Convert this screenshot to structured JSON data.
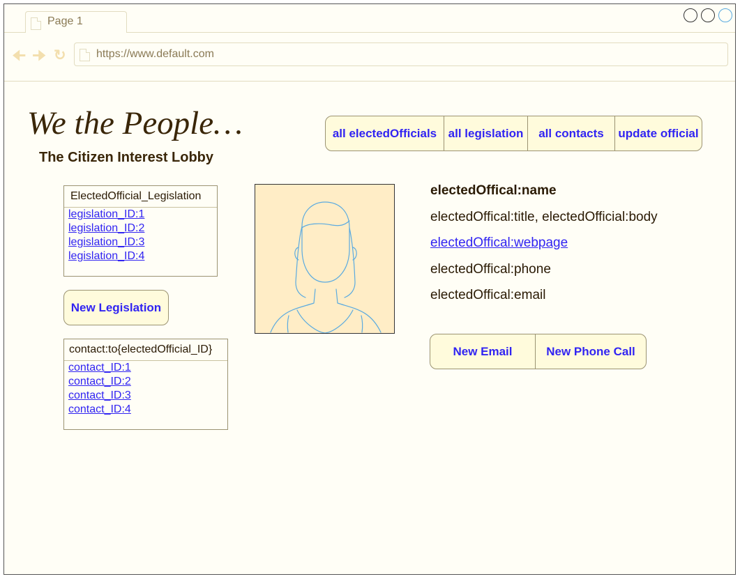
{
  "browser": {
    "tab_title": "Page 1",
    "url": "https://www.default.com"
  },
  "header": {
    "brand": "We the People…",
    "tagline": "The Citizen Interest Lobby"
  },
  "nav": {
    "items": [
      {
        "label": "all electedOfficials"
      },
      {
        "label": "all legislation"
      },
      {
        "label": "all contacts"
      },
      {
        "label": "update official"
      }
    ]
  },
  "legislation_panel": {
    "title": "ElectedOfficial_Legislation",
    "items": [
      "legislation_ID:1",
      "legislation_ID:2",
      "legislation_ID:3",
      "legislation_ID:4"
    ],
    "new_button": "New Legislation"
  },
  "contacts_panel": {
    "title": "contact:to{electedOfficial_ID}",
    "items": [
      "contact_ID:1",
      "contact_ID:2",
      "contact_ID:3",
      "contact_ID:4"
    ]
  },
  "official": {
    "name": "electedOffical:name",
    "title_body": "electedOffical:title, electedOfficial:body",
    "webpage": "electedOffical:webpage",
    "phone": "electedOffical:phone",
    "email": "electedOffical:email"
  },
  "actions": {
    "new_email": "New Email",
    "new_phone_call": "New Phone Call"
  },
  "icons": [
    "document-icon",
    "back-arrow-icon",
    "forward-arrow-icon",
    "reload-icon",
    "avatar-placeholder-icon"
  ],
  "colors": {
    "link": "#3124f2",
    "text": "#3a2608",
    "button_bg": "#fffbdc",
    "photo_bg": "#ffedc6",
    "photo_line": "#5aaae0"
  }
}
